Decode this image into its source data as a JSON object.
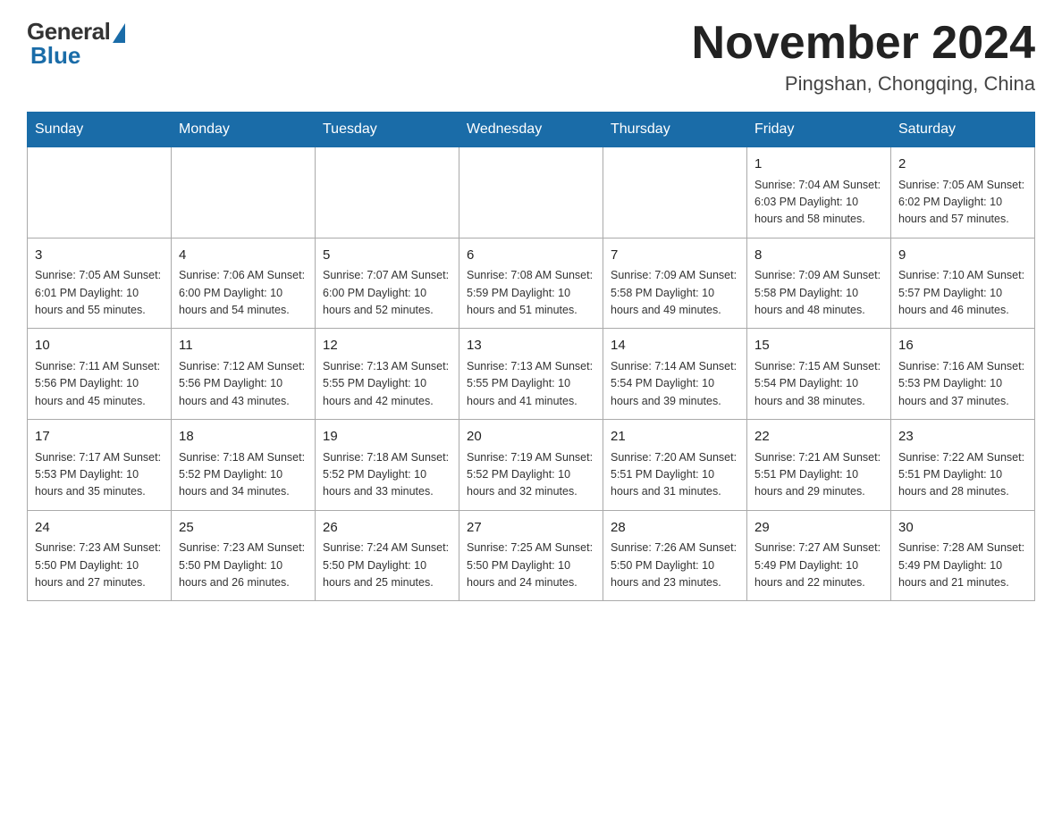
{
  "header": {
    "logo": {
      "general": "General",
      "blue": "Blue"
    },
    "title": "November 2024",
    "location": "Pingshan, Chongqing, China"
  },
  "days_of_week": [
    "Sunday",
    "Monday",
    "Tuesday",
    "Wednesday",
    "Thursday",
    "Friday",
    "Saturday"
  ],
  "weeks": [
    [
      {
        "day": "",
        "info": ""
      },
      {
        "day": "",
        "info": ""
      },
      {
        "day": "",
        "info": ""
      },
      {
        "day": "",
        "info": ""
      },
      {
        "day": "",
        "info": ""
      },
      {
        "day": "1",
        "info": "Sunrise: 7:04 AM\nSunset: 6:03 PM\nDaylight: 10 hours and 58 minutes."
      },
      {
        "day": "2",
        "info": "Sunrise: 7:05 AM\nSunset: 6:02 PM\nDaylight: 10 hours and 57 minutes."
      }
    ],
    [
      {
        "day": "3",
        "info": "Sunrise: 7:05 AM\nSunset: 6:01 PM\nDaylight: 10 hours and 55 minutes."
      },
      {
        "day": "4",
        "info": "Sunrise: 7:06 AM\nSunset: 6:00 PM\nDaylight: 10 hours and 54 minutes."
      },
      {
        "day": "5",
        "info": "Sunrise: 7:07 AM\nSunset: 6:00 PM\nDaylight: 10 hours and 52 minutes."
      },
      {
        "day": "6",
        "info": "Sunrise: 7:08 AM\nSunset: 5:59 PM\nDaylight: 10 hours and 51 minutes."
      },
      {
        "day": "7",
        "info": "Sunrise: 7:09 AM\nSunset: 5:58 PM\nDaylight: 10 hours and 49 minutes."
      },
      {
        "day": "8",
        "info": "Sunrise: 7:09 AM\nSunset: 5:58 PM\nDaylight: 10 hours and 48 minutes."
      },
      {
        "day": "9",
        "info": "Sunrise: 7:10 AM\nSunset: 5:57 PM\nDaylight: 10 hours and 46 minutes."
      }
    ],
    [
      {
        "day": "10",
        "info": "Sunrise: 7:11 AM\nSunset: 5:56 PM\nDaylight: 10 hours and 45 minutes."
      },
      {
        "day": "11",
        "info": "Sunrise: 7:12 AM\nSunset: 5:56 PM\nDaylight: 10 hours and 43 minutes."
      },
      {
        "day": "12",
        "info": "Sunrise: 7:13 AM\nSunset: 5:55 PM\nDaylight: 10 hours and 42 minutes."
      },
      {
        "day": "13",
        "info": "Sunrise: 7:13 AM\nSunset: 5:55 PM\nDaylight: 10 hours and 41 minutes."
      },
      {
        "day": "14",
        "info": "Sunrise: 7:14 AM\nSunset: 5:54 PM\nDaylight: 10 hours and 39 minutes."
      },
      {
        "day": "15",
        "info": "Sunrise: 7:15 AM\nSunset: 5:54 PM\nDaylight: 10 hours and 38 minutes."
      },
      {
        "day": "16",
        "info": "Sunrise: 7:16 AM\nSunset: 5:53 PM\nDaylight: 10 hours and 37 minutes."
      }
    ],
    [
      {
        "day": "17",
        "info": "Sunrise: 7:17 AM\nSunset: 5:53 PM\nDaylight: 10 hours and 35 minutes."
      },
      {
        "day": "18",
        "info": "Sunrise: 7:18 AM\nSunset: 5:52 PM\nDaylight: 10 hours and 34 minutes."
      },
      {
        "day": "19",
        "info": "Sunrise: 7:18 AM\nSunset: 5:52 PM\nDaylight: 10 hours and 33 minutes."
      },
      {
        "day": "20",
        "info": "Sunrise: 7:19 AM\nSunset: 5:52 PM\nDaylight: 10 hours and 32 minutes."
      },
      {
        "day": "21",
        "info": "Sunrise: 7:20 AM\nSunset: 5:51 PM\nDaylight: 10 hours and 31 minutes."
      },
      {
        "day": "22",
        "info": "Sunrise: 7:21 AM\nSunset: 5:51 PM\nDaylight: 10 hours and 29 minutes."
      },
      {
        "day": "23",
        "info": "Sunrise: 7:22 AM\nSunset: 5:51 PM\nDaylight: 10 hours and 28 minutes."
      }
    ],
    [
      {
        "day": "24",
        "info": "Sunrise: 7:23 AM\nSunset: 5:50 PM\nDaylight: 10 hours and 27 minutes."
      },
      {
        "day": "25",
        "info": "Sunrise: 7:23 AM\nSunset: 5:50 PM\nDaylight: 10 hours and 26 minutes."
      },
      {
        "day": "26",
        "info": "Sunrise: 7:24 AM\nSunset: 5:50 PM\nDaylight: 10 hours and 25 minutes."
      },
      {
        "day": "27",
        "info": "Sunrise: 7:25 AM\nSunset: 5:50 PM\nDaylight: 10 hours and 24 minutes."
      },
      {
        "day": "28",
        "info": "Sunrise: 7:26 AM\nSunset: 5:50 PM\nDaylight: 10 hours and 23 minutes."
      },
      {
        "day": "29",
        "info": "Sunrise: 7:27 AM\nSunset: 5:49 PM\nDaylight: 10 hours and 22 minutes."
      },
      {
        "day": "30",
        "info": "Sunrise: 7:28 AM\nSunset: 5:49 PM\nDaylight: 10 hours and 21 minutes."
      }
    ]
  ]
}
